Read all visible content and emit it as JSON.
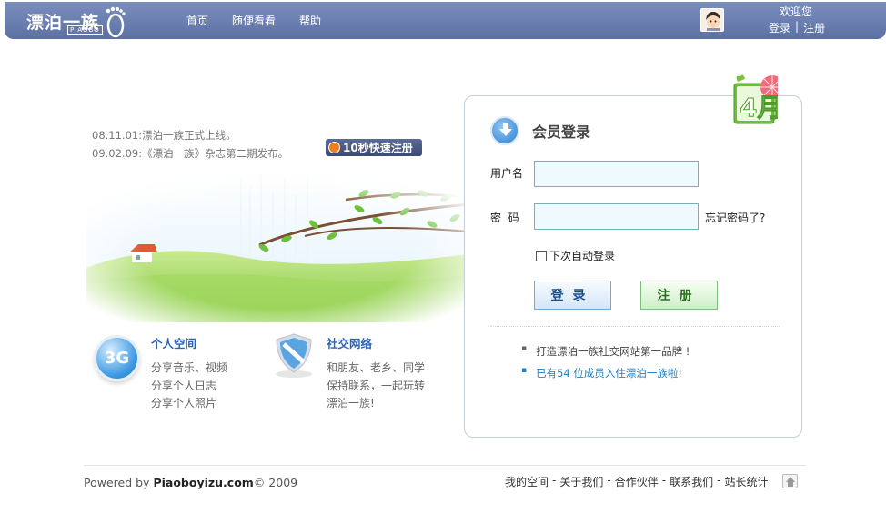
{
  "header": {
    "logo_text": "漂泊一族",
    "logo_sub": "PIAOBO",
    "nav": [
      {
        "label": "首页"
      },
      {
        "label": "随便看看"
      },
      {
        "label": "帮助"
      }
    ],
    "welcome": "欢迎您",
    "login_link": "登录",
    "separator": "|",
    "register_link": "注册"
  },
  "news": [
    "08.11.01:漂泊一族正式上线。",
    "09.02.09:《漂泊一族》杂志第二期发布。"
  ],
  "quick_register": "10秒快速注册",
  "features": [
    {
      "title": "个人空间",
      "badge": "3G",
      "lines": [
        "分享音乐、视频",
        "分享个人日志",
        "分享个人照片"
      ]
    },
    {
      "title": "社交网络",
      "lines": [
        "和朋友、老乡、同学",
        "保持联系，一起玩转",
        "漂泊一族!"
      ]
    }
  ],
  "login": {
    "title": "会员登录",
    "username_label": "用户名",
    "username_value": "",
    "password_label": "密  码",
    "password_value": "",
    "forgot": "忘记密码了?",
    "remember": "下次自动登录",
    "login_button": "登录",
    "register_button": "注册",
    "month_badge": "4月",
    "tips": [
      {
        "text": "打造漂泊一族社交网站第一品牌 !",
        "color": "#444444"
      },
      {
        "text": "已有54 位成员入住漂泊一族啦!",
        "color": "#1f7fc2"
      }
    ]
  },
  "footer": {
    "powered_prefix": "Powered by ",
    "powered_site": "Piaoboyizu.com",
    "powered_suffix": "© 2009",
    "links": [
      "我的空间",
      "关于我们",
      "合作伙伴",
      "联系我们",
      "站长统计"
    ]
  }
}
